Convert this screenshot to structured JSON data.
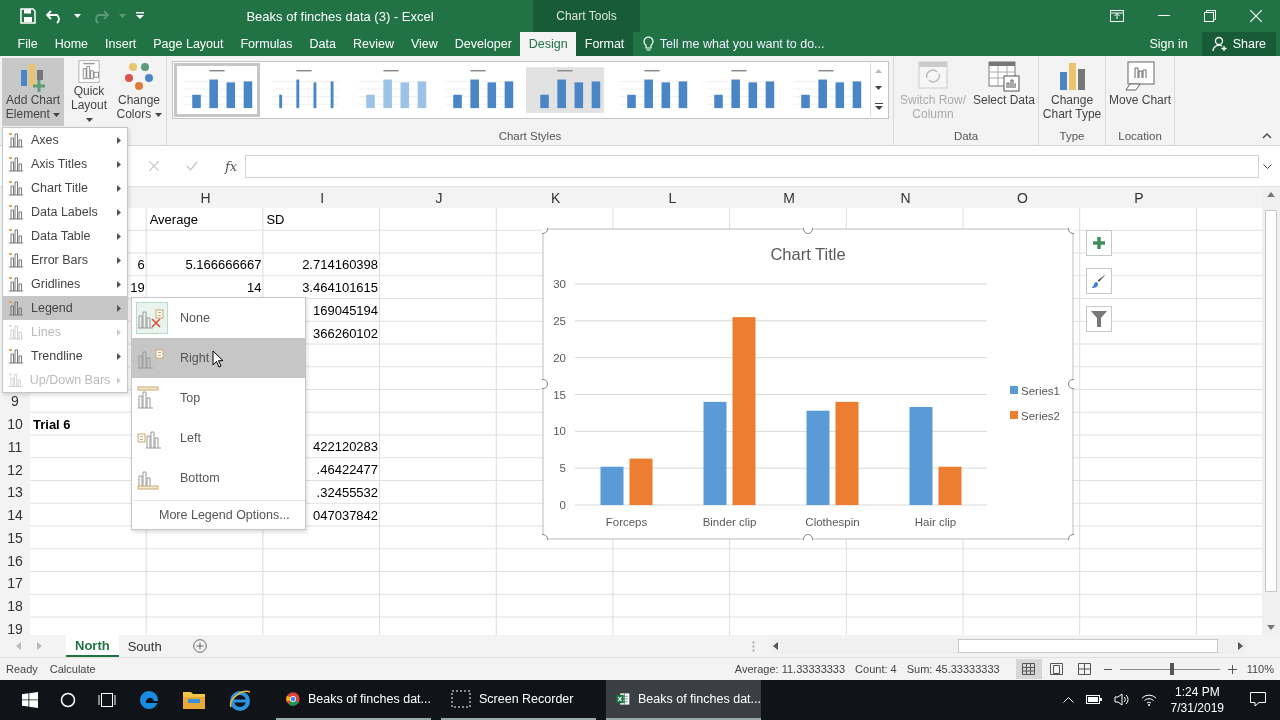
{
  "title_bar": {
    "title": "Beaks of finches data (3) - Excel",
    "context_label": "Chart Tools"
  },
  "tabs": [
    {
      "label": "File",
      "selected": false,
      "contextual": false
    },
    {
      "label": "Home",
      "selected": false,
      "contextual": false
    },
    {
      "label": "Insert",
      "selected": false,
      "contextual": false
    },
    {
      "label": "Page Layout",
      "selected": false,
      "contextual": false
    },
    {
      "label": "Formulas",
      "selected": false,
      "contextual": false
    },
    {
      "label": "Data",
      "selected": false,
      "contextual": false
    },
    {
      "label": "Review",
      "selected": false,
      "contextual": false
    },
    {
      "label": "View",
      "selected": false,
      "contextual": false
    },
    {
      "label": "Developer",
      "selected": false,
      "contextual": false
    },
    {
      "label": "Design",
      "selected": true,
      "contextual": true
    },
    {
      "label": "Format",
      "selected": false,
      "contextual": true
    }
  ],
  "tell_me": {
    "placeholder": "Tell me what you want to do..."
  },
  "account": {
    "sign_in": "Sign in",
    "share": "Share"
  },
  "ribbon": {
    "layout_buttons": [
      {
        "kind": "add_element",
        "label": "Add Chart Element",
        "pressed": true
      },
      {
        "kind": "quick_layout",
        "label": "Quick Layout",
        "pressed": false
      },
      {
        "kind": "colors",
        "label": "Change Colors",
        "pressed": false
      }
    ],
    "chart_styles": {
      "label": "Chart Styles",
      "styles": [
        {
          "selected": true
        },
        {
          "selected": false
        },
        {
          "selected": false
        },
        {
          "selected": false
        },
        {
          "selected": false
        },
        {
          "selected": false
        },
        {
          "selected": false
        },
        {
          "selected": false
        }
      ]
    },
    "groups": [
      {
        "label": "Data",
        "buttons": [
          {
            "kind": "switch",
            "label": "Switch Row/ Column",
            "disabled": true
          },
          {
            "kind": "select",
            "label": "Select Data",
            "disabled": false
          }
        ]
      },
      {
        "label": "Type",
        "buttons": [
          {
            "kind": "change_type",
            "label": "Change Chart Type",
            "disabled": false
          }
        ]
      },
      {
        "label": "Location",
        "buttons": [
          {
            "kind": "move",
            "label": "Move Chart",
            "disabled": false
          }
        ]
      }
    ]
  },
  "formula_bar": {
    "function_label": "fx"
  },
  "sheet": {
    "columns": [
      "H",
      "I",
      "J",
      "K",
      "L",
      "M",
      "N",
      "O",
      "P"
    ],
    "rows": [
      {
        "kind": "label",
        "h": "Average",
        "i": "SD"
      },
      {},
      {
        "kind": "number",
        "g": "6",
        "h": "5.166666667",
        "i": "2.714160398"
      },
      {
        "kind": "number",
        "g": "19",
        "h": "14",
        "i": "3.464101615"
      },
      {
        "kind": "number",
        "i": "169045194"
      },
      {
        "kind": "number",
        "i": "366260102"
      },
      {},
      {},
      {
        "header": "9"
      },
      {
        "header": "10",
        "kind": "title",
        "g": "Trial 6"
      },
      {
        "header": "11",
        "kind": "number",
        "i": "422120283"
      },
      {
        "header": "12",
        "kind": "number",
        "i": ".46422477"
      },
      {
        "header": "13",
        "kind": "number",
        "i": ".32455532"
      },
      {
        "header": "14",
        "kind": "number",
        "i": "047037842"
      },
      {
        "header": "15"
      },
      {
        "header": "16"
      },
      {
        "header": "17"
      },
      {
        "header": "18"
      },
      {
        "header": "19"
      }
    ]
  },
  "chart": {
    "chart_data": {
      "type": "bar",
      "title": "Chart Title",
      "categories": [
        "Forceps",
        "Binder clip",
        "Clothespin",
        "Hair clip"
      ],
      "series": [
        {
          "name": "Series1",
          "color": "#5b9bd5",
          "values": [
            5.2,
            14,
            12.8,
            13.3
          ]
        },
        {
          "name": "Series2",
          "color": "#ed7d31",
          "values": [
            6.3,
            25.5,
            14,
            5.2
          ]
        }
      ],
      "ylim": [
        0,
        30
      ],
      "yticks": [
        0,
        5,
        10,
        15,
        20,
        25,
        30
      ],
      "grid": true,
      "legend": true
    }
  },
  "chart_menu": {
    "items": [
      {
        "label": "Axes",
        "disabled": false,
        "selected": false
      },
      {
        "label": "Axis Titles",
        "disabled": false,
        "selected": false
      },
      {
        "label": "Chart Title",
        "disabled": false,
        "selected": false
      },
      {
        "label": "Data Labels",
        "disabled": false,
        "selected": false
      },
      {
        "label": "Data Table",
        "disabled": false,
        "selected": false
      },
      {
        "label": "Error Bars",
        "disabled": false,
        "selected": false
      },
      {
        "label": "Gridlines",
        "disabled": false,
        "selected": false
      },
      {
        "label": "Legend",
        "disabled": false,
        "selected": true
      },
      {
        "label": "Lines",
        "disabled": true,
        "selected": false
      },
      {
        "label": "Trendline",
        "disabled": false,
        "selected": false
      },
      {
        "label": "Up/Down Bars",
        "disabled": true,
        "selected": false
      }
    ],
    "submenu": [
      {
        "kind": "none",
        "label": "None",
        "selected": false
      },
      {
        "kind": "right",
        "label": "Right",
        "selected": true
      },
      {
        "kind": "top",
        "label": "Top",
        "selected": false
      },
      {
        "kind": "left",
        "label": "Left",
        "selected": false
      },
      {
        "kind": "bottom",
        "label": "Bottom",
        "selected": false
      }
    ],
    "more_options": "More Legend Options..."
  },
  "sheet_tabs": [
    {
      "label": "North",
      "selected": true
    },
    {
      "label": "South",
      "selected": false
    }
  ],
  "status_bar": {
    "mode": "Ready",
    "calculate": "Calculate",
    "average": "Average: 11.33333333",
    "count": "Count: 4",
    "sum": "Sum: 45.33333333",
    "views": [
      {
        "kind": "normal",
        "selected": true
      },
      {
        "kind": "page_layout",
        "selected": false
      },
      {
        "kind": "page_break",
        "selected": false
      }
    ],
    "zoom": {
      "level": 0.52
    },
    "zoom_label": "110%"
  },
  "taskbar": {
    "pinned": [
      {
        "kind": "edge"
      },
      {
        "kind": "explorer"
      },
      {
        "kind": "ie"
      }
    ],
    "apps": [
      {
        "kind": "chrome",
        "label": "Beaks of finches dat...",
        "active": false
      },
      {
        "kind": "recorder",
        "label": "Screen Recorder",
        "active": false
      },
      {
        "kind": "excel",
        "label": "Beaks of finches dat...",
        "active": true
      }
    ],
    "time": "1:24 PM",
    "date": "7/31/2019"
  }
}
